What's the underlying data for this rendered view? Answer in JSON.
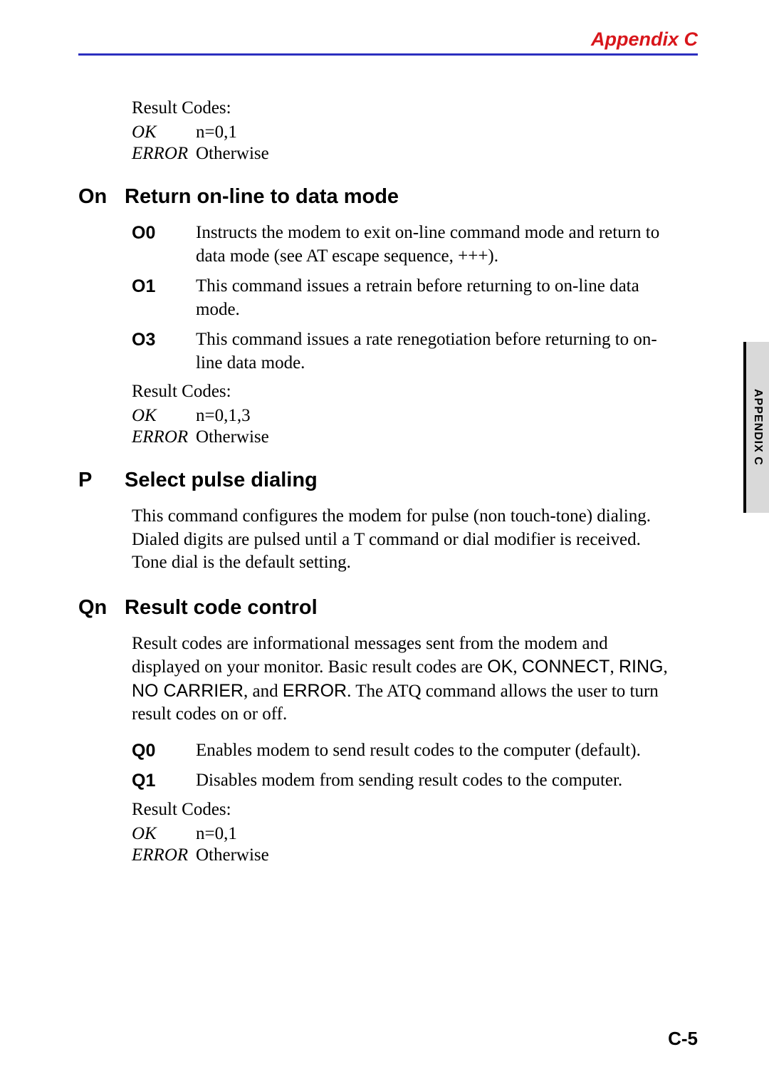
{
  "header": {
    "appendix": "Appendix C"
  },
  "intro_rc": {
    "label": "Result Codes:",
    "ok_key": "OK",
    "ok_val": "n=0,1",
    "err_key": "ERROR",
    "err_val": "Otherwise"
  },
  "section_on": {
    "code": "On",
    "title": "Return on-line to data mode",
    "items": [
      {
        "term": "O0",
        "desc": "Instructs the modem to exit on-line command mode and return to data mode (see AT escape sequence, +++)."
      },
      {
        "term": "O1",
        "desc": "This command issues a retrain before returning to on-line data mode."
      },
      {
        "term": "O3",
        "desc": "This command issues a rate renegotiation before returning to on-line data mode."
      }
    ],
    "rc": {
      "label": "Result Codes:",
      "ok_key": "OK",
      "ok_val": "n=0,1,3",
      "err_key": "ERROR",
      "err_val": "Otherwise"
    }
  },
  "section_p": {
    "code": "P",
    "title": "Select pulse dialing",
    "para": "This command configures the modem for pulse (non touch-tone) dialing. Dialed digits are pulsed until a T command or dial modifier is received. Tone dial is the default setting."
  },
  "section_qn": {
    "code": "Qn",
    "title": "Result code control",
    "para_pre": "Result codes are informational messages sent from the modem and displayed on your monitor. Basic result codes are ",
    "kw1": "OK",
    "sep1": ", ",
    "kw2": "CONNECT",
    "sep2": ", ",
    "kw3": "RING",
    "sep3": ", ",
    "kw4": "NO CARRIER",
    "sep4": ", and ",
    "kw5": "ERROR",
    "post1": ". ",
    "para_post": "The ATQ command allows the user to turn result codes on or off.",
    "items": [
      {
        "term": "Q0",
        "desc": "Enables modem to send result codes to the computer (default)."
      },
      {
        "term": "Q1",
        "desc": "Disables modem from sending result codes to the computer."
      }
    ],
    "rc": {
      "label": "Result Codes:",
      "ok_key": "OK",
      "ok_val": "n=0,1",
      "err_key": "ERROR",
      "err_val": "Otherwise"
    }
  },
  "side_tab": "APPENDIX C",
  "page_number": "C-5"
}
